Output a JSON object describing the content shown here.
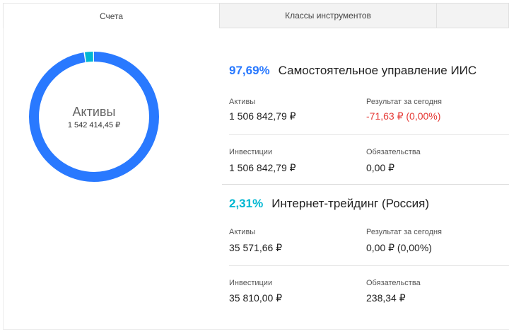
{
  "tabs": [
    {
      "label": "Счета"
    },
    {
      "label": "Классы инструментов"
    },
    {
      "label": ""
    }
  ],
  "summary": {
    "title": "Активы",
    "value": "1 542 414,45 ₽"
  },
  "colors": {
    "primary_blue": "#2979ff",
    "teal": "#00b7d2",
    "negative": "#e53935"
  },
  "donut_shares": [
    97.69,
    2.31
  ],
  "accounts": [
    {
      "percent": "97,69%",
      "percent_color": "#2979ff",
      "name": "Самостоятельное управление ИИС",
      "assets_label": "Активы",
      "assets": "1 506 842,79 ₽",
      "result_label": "Результат за сегодня",
      "result": "-71,63 ₽  (0,00%)",
      "investments_label": "Инвестиции",
      "investments": "1 506 842,79 ₽",
      "liabilities_label": "Обязательства",
      "liabilities": "0,00 ₽"
    },
    {
      "percent": "2,31%",
      "percent_color": "#00b7d2",
      "name": "Интернет-трейдинг (Россия)",
      "assets_label": "Активы",
      "assets": "35 571,66 ₽",
      "result_label": "Результат за сегодня",
      "result": "0,00 ₽  (0,00%)",
      "investments_label": "Инвестиции",
      "investments": "35 810,00 ₽",
      "liabilities_label": "Обязательства",
      "liabilities": "238,34 ₽"
    }
  ]
}
